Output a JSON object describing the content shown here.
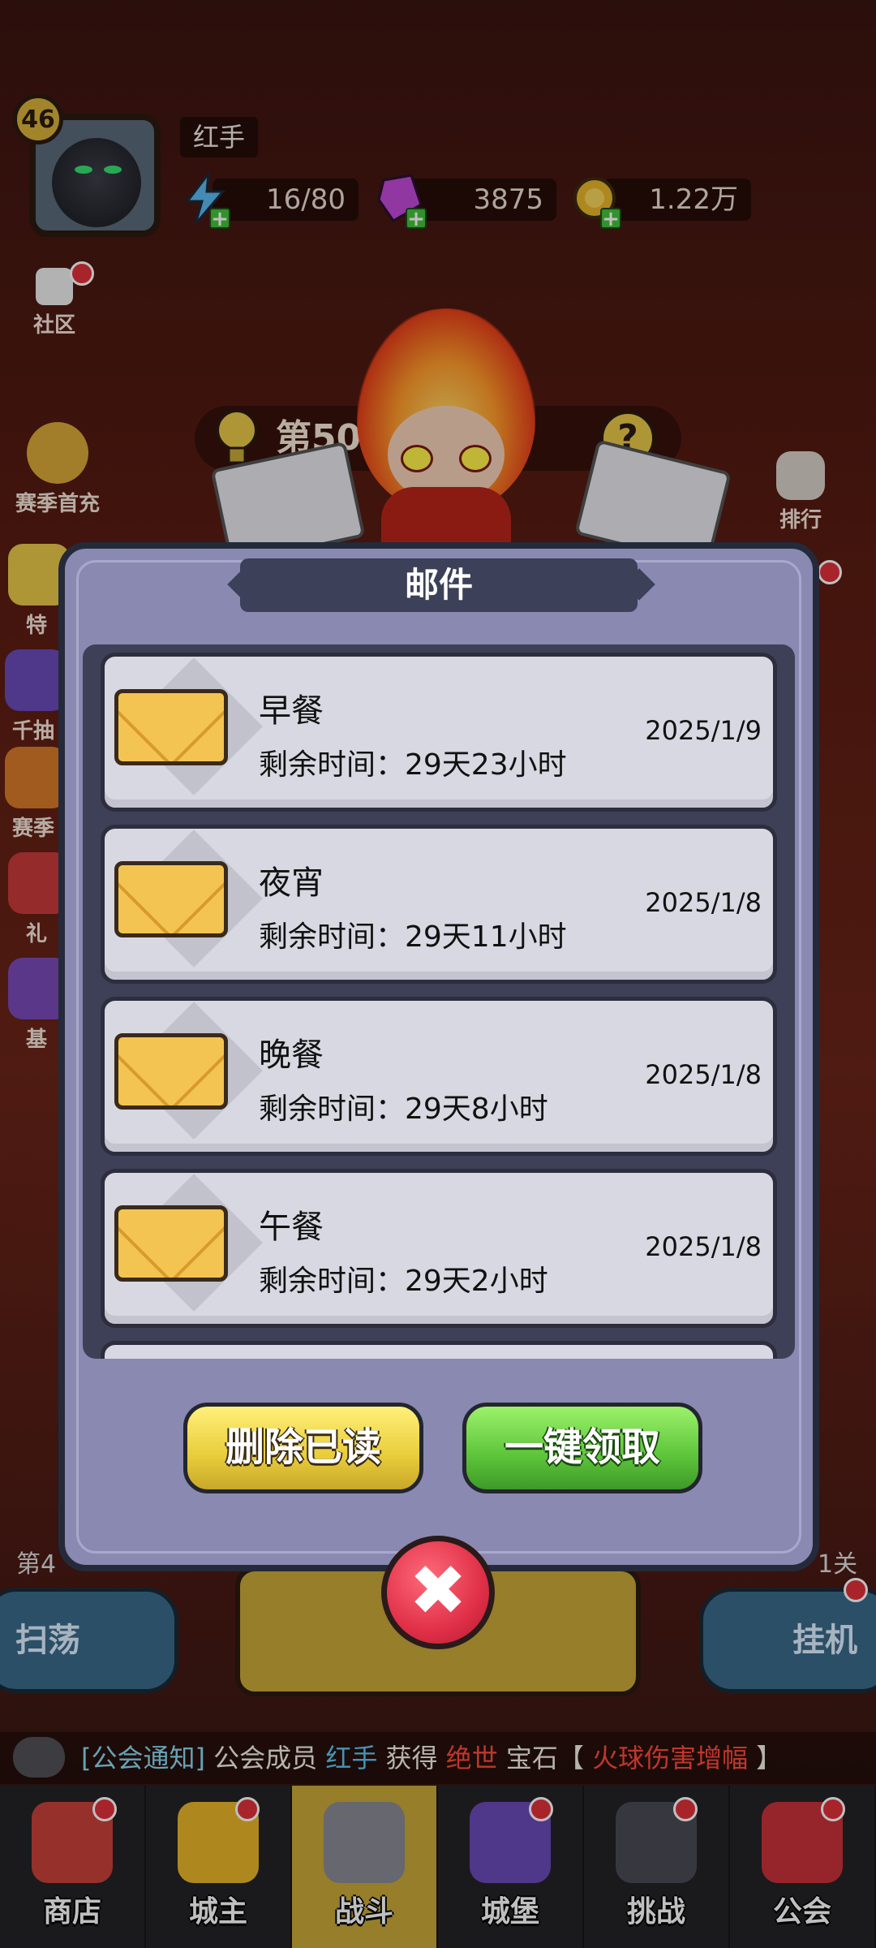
{
  "player": {
    "level": "46",
    "name": "红手"
  },
  "resources": {
    "stamina": "16/80",
    "gems": "3875",
    "gold": "1.22万"
  },
  "side_menu": {
    "community": "社区",
    "season_recharge": "赛季首充",
    "special": "特",
    "thousand": "千抽",
    "season": "赛季",
    "gift": "礼",
    "base": "基",
    "rank": "排行"
  },
  "stage": {
    "banner": "第50章",
    "left_hint": "第4",
    "right_hint": "1关"
  },
  "dialog": {
    "title": "邮件",
    "mails": [
      {
        "title": "早餐",
        "remaining": "剩余时间：29天23小时",
        "date": "2025/1/9"
      },
      {
        "title": "夜宵",
        "remaining": "剩余时间：29天11小时",
        "date": "2025/1/8"
      },
      {
        "title": "晚餐",
        "remaining": "剩余时间：29天8小时",
        "date": "2025/1/8"
      },
      {
        "title": "午餐",
        "remaining": "剩余时间：29天2小时",
        "date": "2025/1/8"
      }
    ],
    "delete_read": "删除已读",
    "claim_all": "一键领取",
    "close": "✖"
  },
  "actions": {
    "sweep": "扫荡",
    "idle": "挂机"
  },
  "notice": {
    "tag": "[公会通知]",
    "text1": "公会成员",
    "member": "红手",
    "text2": "获得",
    "quality": "绝世",
    "text3": "宝石【",
    "item": "火球伤害增幅",
    "text4": "】"
  },
  "nav": {
    "tabs": [
      "商店",
      "城主",
      "战斗",
      "城堡",
      "挑战",
      "公会"
    ]
  },
  "colors": {
    "dialog_bg": "#8a89b2",
    "accent_yellow": "#e8cc3a",
    "accent_green": "#5cc43a",
    "close_red": "#e03048"
  }
}
